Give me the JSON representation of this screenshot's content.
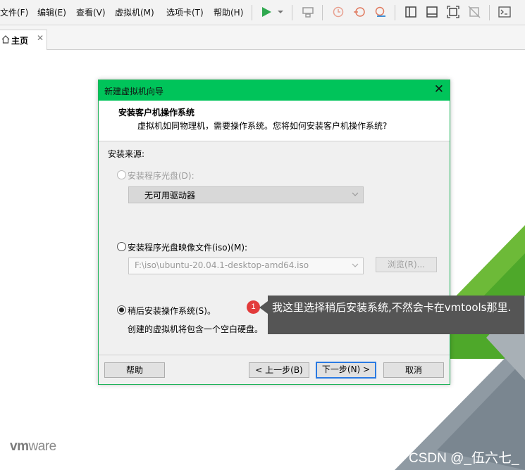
{
  "menu": [
    "文件(F)",
    "编辑(E)",
    "查看(V)",
    "虚拟机(M)",
    "选项卡(T)",
    "帮助(H)"
  ],
  "toolbar": {
    "icons": [
      "play-icon",
      "dropdown-icon",
      "send-keys-icon",
      "snapshot-icon",
      "revert-snapshot-icon",
      "manage-snapshots-icon",
      "sidebar-icon",
      "thumbnail-icon",
      "fullscreen-icon",
      "unity-icon",
      "console-icon"
    ],
    "accent": "#2fa84f"
  },
  "tab": {
    "label": "主页"
  },
  "dialog": {
    "title": "新建虚拟机向导",
    "heading": "安装客户机操作系统",
    "subheading": "虚拟机如同物理机，需要操作系统。您将如何安装客户机操作系统?",
    "source_label": "安装来源:",
    "option_disc": "安装程序光盘(D):",
    "disc_value": "无可用驱动器",
    "option_iso": "安装程序光盘映像文件(iso)(M):",
    "iso_value": "F:\\iso\\ubuntu-20.04.1-desktop-amd64.iso",
    "browse": "浏览(R)...",
    "option_later": "稍后安装操作系统(S)。",
    "later_desc": "创建的虚拟机将包含一个空白硬盘。",
    "selected": "later",
    "buttons": {
      "help": "帮助",
      "back": "< 上一步(B)",
      "next": "下一步(N) >",
      "cancel": "取消"
    },
    "accent": "#00c45a"
  },
  "annotation": {
    "number": "1",
    "text": "我这里选择稍后安装系统,不然会卡在vmtools那里.",
    "badge_color": "#e23b3b"
  },
  "branding": {
    "logo_prefix": "vm",
    "logo_suffix": "ware",
    "watermark": "CSDN @_伍六七_"
  }
}
